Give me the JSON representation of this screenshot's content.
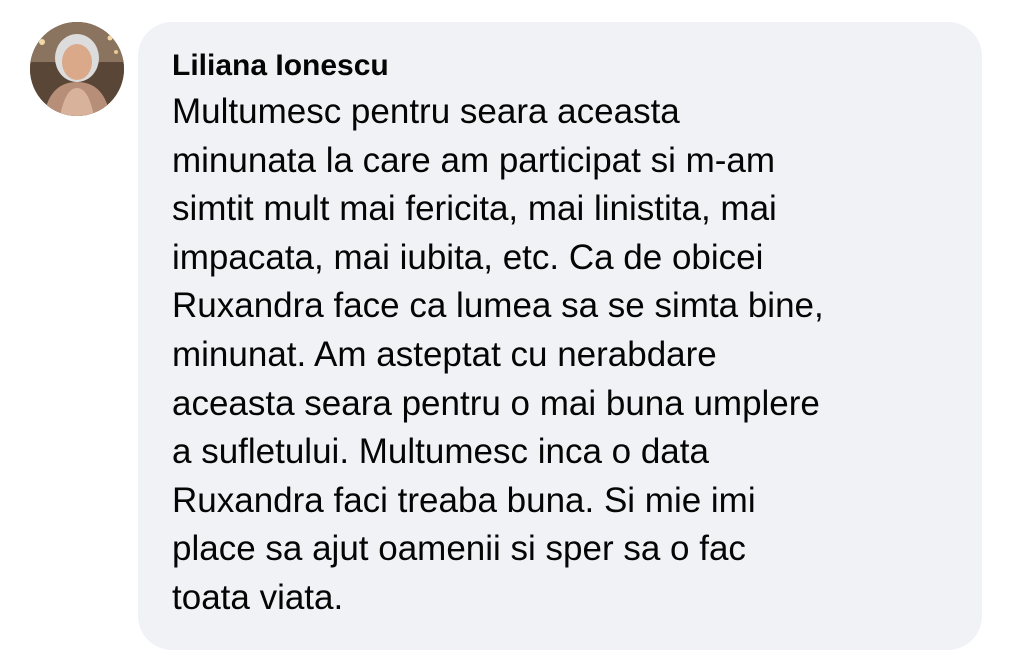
{
  "comment": {
    "author": "Liliana Ionescu",
    "avatar_icon": "user-avatar-photo",
    "lines": [
      "Multumesc pentru seara aceasta",
      "minunata la care am participat si m-am",
      "simtit mult mai fericita, mai linistita, mai",
      "impacata, mai iubita, etc. Ca de obicei",
      "Ruxandra face ca lumea sa se simta bine,",
      "minunat. Am asteptat cu nerabdare",
      "aceasta seara pentru o mai buna umplere",
      "a sufletului. Multumesc inca o data",
      "Ruxandra faci treaba buna. Si mie imi",
      "place sa ajut oamenii si sper sa o fac",
      "toata viata."
    ]
  },
  "colors": {
    "bubble_background": "#f0f2f5",
    "text": "#050505"
  }
}
